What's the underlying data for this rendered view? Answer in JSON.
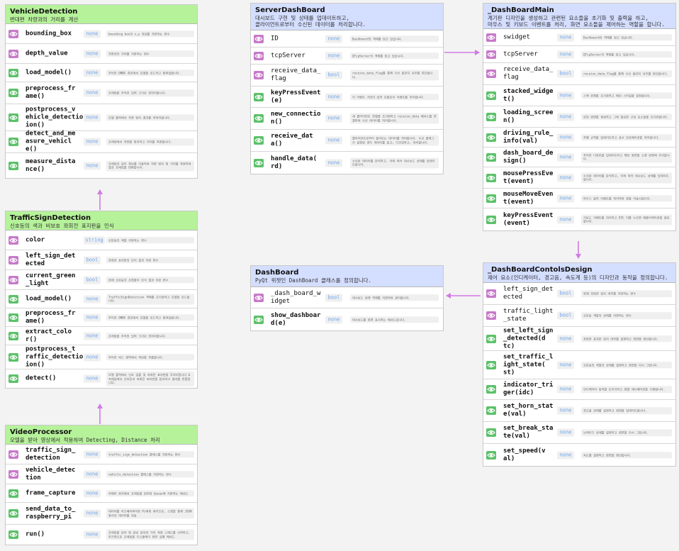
{
  "cards": [
    {
      "id": "vehicle_detection",
      "title": "VehicleDetection",
      "subtitle": "번대편 차량과의 거리를 계산",
      "rows": [
        {
          "name": "bounding_box",
          "bold": true,
          "access": "private",
          "type": "none",
          "desc": "bounding box의 x,y 좌표를 저장하는 변수"
        },
        {
          "name": "depth_value",
          "bold": true,
          "access": "private",
          "type": "none",
          "desc": "차량과의 거리를 저장하는 변수"
        },
        {
          "name": "load_model()",
          "bold": true,
          "access": "public",
          "type": "none",
          "desc": "주어진 ONNX 경로에서 모델을 로드하고 컴파일합니다."
        },
        {
          "name": "preprocess_fr\name()",
          "bold": true,
          "access": "public",
          "type": "none",
          "desc": "프레임을 주어진 입력 크기로 전처리합니다."
        },
        {
          "name": "postprocess_v\nehicle_detection\nion()",
          "bold": true,
          "access": "public",
          "type": "none",
          "desc": "모델 출력에서 차량 탐지 결과를 후처리합니다."
        },
        {
          "name": "detect_and_me\nasure_vehicl\ne()",
          "bold": true,
          "access": "public",
          "type": "none",
          "desc": "프레임에서 차량을 탐지하고 거리를 측정합니다."
        },
        {
          "name": "measure_dista\nnce()",
          "bold": true,
          "access": "public",
          "type": "none",
          "desc": "프레임의 깊이 정보를 이용하여 차량 탐지 및 거리를 측정하여 결과 프레임을 반환합니다."
        }
      ]
    },
    {
      "id": "traffic_sign_detection",
      "title": "TrafficSignDetection",
      "subtitle": "신호등의 색과 비보호 좌회전 표지판을 인식",
      "rows": [
        {
          "name": "color",
          "bold": true,
          "access": "private",
          "type": "string",
          "desc": "신호등의 색을 저장하는 변수"
        },
        {
          "name": "left_sign_det\nected",
          "bold": true,
          "access": "private",
          "type": "bool",
          "desc": "좌회전 표지판의 인식 결과 저장 변수"
        },
        {
          "name": "current_green\n_light",
          "bold": true,
          "access": "private",
          "type": "bool",
          "desc": "현재 신호등의 초록불이 인식 결과 저장 변수"
        },
        {
          "name": "load_model()",
          "bold": true,
          "access": "public",
          "type": "none",
          "desc": "TrafficSignDetection 객체를 초기화하고 모델을 로드합니다."
        },
        {
          "name": "preprocess_fr\name()",
          "bold": true,
          "access": "public",
          "type": "none",
          "desc": "주어진 ONNX 경로에서 모델을 로드하고 컴파일합니다."
        },
        {
          "name": "extract_colo\nr()",
          "bold": true,
          "access": "public",
          "type": "none",
          "desc": "프레임을 주어진 입력 크기로 전처리합니다."
        },
        {
          "name": "postprocess_t\nraffic_detection\nion()",
          "bold": true,
          "access": "public",
          "type": "none",
          "desc": "주어진 박스 영역에서 색상을 추출합니다."
        },
        {
          "name": "detect()",
          "bold": true,
          "access": "public",
          "type": "none",
          "desc": "모델 출력에서 신호 검출 및 좌회전 표지판을 후처리합니다 & 프레임에서 신호등과 좌회전 표지판을 탐지하고 결과를 반환합니다."
        }
      ]
    },
    {
      "id": "video_processor",
      "title": "VideoProcessor",
      "subtitle": "모델을 받아 영상에서 적용하여 Detecting, Distance 처리",
      "rows": [
        {
          "name": "traffic_sign_\ndetection",
          "bold": true,
          "access": "private",
          "type": "none",
          "desc": "traffic_sign_detection 클래스를 저장하는 변수"
        },
        {
          "name": "vehicle_detec\ntion",
          "bold": true,
          "access": "private",
          "type": "none",
          "desc": "vehicle_detection 클래스를 저장하는 변수"
        },
        {
          "name": "frame_capture",
          "bold": true,
          "access": "public",
          "type": "none",
          "desc": "카메라 장치에서 프레임을 읽어와 Queue에 저장하는 메서드"
        },
        {
          "name": "send_data_to_\nraspberry_pi",
          "bold": true,
          "access": "public",
          "type": "none",
          "desc": "데이터를 라즈베리파이와 Pi에게 워커으로, 소켓을 통해 JSON 형식의 데이터를 전송"
        },
        {
          "name": "run()",
          "bold": true,
          "access": "public",
          "type": "none",
          "desc": "프레임을 읽어 및 감상 감지와 거리 측정 스레드를 시작하고, 주기적으로 프레임을 디스플레이 화면 실행 메서드"
        }
      ]
    },
    {
      "id": "server_dashboard",
      "title": "ServerDashBoard",
      "subtitle": "대시보드 구현 및 상태를 업데이트하고,\n클라이언트로부터 수신된 데이터를 처리합니다.",
      "rows": [
        {
          "name": "ID",
          "bold": false,
          "access": "private",
          "type": "none",
          "desc": "Dashboard의 객체를 담고 있습니다."
        },
        {
          "name": "tcpServer",
          "bold": false,
          "access": "private",
          "type": "none",
          "desc": "QTcpServer의 객체를 담고 있습니다."
        },
        {
          "name": "receive_data_\nflag",
          "bold": false,
          "access": "private",
          "type": "bool",
          "desc": "receive_data_flag를 통해 수신 중인지 유무를 판단합니다."
        },
        {
          "name": "keyPressEvent\n(e)",
          "bold": true,
          "access": "public",
          "type": "none",
          "desc": "키 이벤트 기반의 입력 모듈로서 이벤트를 처리합니다."
        },
        {
          "name": "new_connectio\nn()",
          "bold": true,
          "access": "public",
          "type": "none",
          "desc": "새 클라이언트 연결을 초기화하고 receive_data 메서드를 연결하여 수신 데이터를 처리합니다."
        },
        {
          "name": "receive_dat\na()",
          "bold": true,
          "access": "public",
          "type": "none",
          "desc": "클라이언트로부터 들어오는 데이터를 처리합니다. 수신 플래그가 설정된 경우 데이터를 읽고, 디코딩하고, 처리합니다."
        },
        {
          "name": "handle_data(\nrd)",
          "bold": true,
          "access": "public",
          "type": "none",
          "desc": "수신된 데이터를 분석하고, 이에 따라 대시보드 상태를 업데이트합니다."
        }
      ]
    },
    {
      "id": "dashboard_main",
      "title": "_DashBoardMain",
      "subtitle": "계기판 디자인을 생성하고 관련된 요소들을 초기화 및 출력을 하고,\n마우스 및 키보드 이벤트를 처리, 화면 요소들을 제어하는 역할을 합니다.",
      "rows": [
        {
          "name": "swidget",
          "bold": false,
          "access": "private",
          "type": "none",
          "desc": "Dashboard의 객체를 담고 있습니다."
        },
        {
          "name": "tcpServer",
          "bold": false,
          "access": "private",
          "type": "none",
          "desc": "QTcpServer의 객체를 담고 있습니다."
        },
        {
          "name": "receive_data_\nflag",
          "bold": false,
          "access": "private",
          "type": "bool",
          "desc": "receive_data_flag를 통해 수신 중인지 유무를 판단합니다."
        },
        {
          "name": "stacked_widge\nt()",
          "bold": true,
          "access": "public",
          "type": "none",
          "desc": "스택 위젯을 초기화하고 메인 스타일을 설정합니다."
        },
        {
          "name": "loading_scree\nn()",
          "bold": true,
          "access": "public",
          "type": "none",
          "desc": "로딩 화면을 생성하고 그에 필요한 구성 요소들을 초기화합니다."
        },
        {
          "name": "driving_rule_\ninfo(val)",
          "bold": true,
          "access": "public",
          "type": "none",
          "desc": "주행 규칙을 업데이트하고 표시 인포메이션을 처리합니다."
        },
        {
          "name": "dash_board_de\nsign()",
          "bold": true,
          "access": "public",
          "type": "none",
          "desc": "주어진 디자인을 업데이트하고 해당 화면을 소켓 위젯에 추가합니다."
        },
        {
          "name": "mousePressEve\nt(event)",
          "bold": true,
          "access": "public",
          "type": "none",
          "desc": "수신된 데이터를 분석하고, 이에 따라 대시보드 상태를 업데이트합니다."
        },
        {
          "name": "mouseMoveEven\nt(event)",
          "bold": true,
          "access": "public",
          "type": "none",
          "desc": "마우스 움직 이벤트를 처리하여 창을 이동시킵니다."
        },
        {
          "name": "keyPressEvent\n(event)",
          "bold": true,
          "access": "public",
          "type": "none",
          "desc": "키보드 이벤트를 처리하고 ESC 키를 누르면 애플리케이션을 종료합니다."
        }
      ]
    },
    {
      "id": "dashboard",
      "title": "DashBoard",
      "subtitle": "PyQt 위젯인 DashBoard 클래스를 정의합니다.",
      "rows": [
        {
          "name": "_dash_board_w\nidget",
          "bold": false,
          "access": "private",
          "type": "bool",
          "desc": "대시보드 위젯 객체를 저장하여 관리합니다."
        },
        {
          "name": "show_dashboar\nd(e)",
          "bold": true,
          "access": "public",
          "type": "none",
          "desc": "대시보드를 화면 표시하는 메서드입니다."
        }
      ]
    },
    {
      "id": "dashboard_controls_design",
      "title": "_DashBoardContolsDesign",
      "subtitle": "제어 요소(인디케이터, 경고음, 속도계 등)의 디자인과 동작을 정의합니다.",
      "rows": [
        {
          "name": "left_sign_det\nected",
          "bold": false,
          "access": "private",
          "type": "bool",
          "desc": "현재 좌회전 감지 여부를 저장하는 변수"
        },
        {
          "name": "traffic_light\n_state",
          "bold": false,
          "access": "private",
          "type": "bool",
          "desc": "신호등 색깔의 상태를 저장하는 변수"
        },
        {
          "name": "set_left_sign\n_detected(d\ntc)",
          "bold": true,
          "access": "public",
          "type": "none",
          "desc": "좌회전 표지판 감지 여부를 설정하고 화면을 갱신합니다."
        },
        {
          "name": "set_traffic_l\night_state(\nst)",
          "bold": true,
          "access": "public",
          "type": "none",
          "desc": "신호등의 색깔의 상태를 설정하고 화면을 다시 그립니다."
        },
        {
          "name": "indicator_tri\nger(idc)",
          "bold": true,
          "access": "public",
          "type": "none",
          "desc": "인디케이터 동작을 트리거하고 점멸 애니메이션을 수행합니다."
        },
        {
          "name": "set_horn_stat\ne(val)",
          "bold": true,
          "access": "public",
          "type": "none",
          "desc": "경고음 상태를 설정하고 화면을 업데이트합니다."
        },
        {
          "name": "set_break_sta\nte(val)",
          "bold": true,
          "access": "public",
          "type": "none",
          "desc": "브레이크 상태를 설정하고 화면을 다시 그립니다."
        },
        {
          "name": "set_speed(v\nal)",
          "bold": true,
          "access": "public",
          "type": "none",
          "desc": "속도를 설정하고 화면을 갱신합니다."
        }
      ]
    }
  ],
  "colors": {
    "green_header": "#b6f29a",
    "blue_header": "#d4deff",
    "private": "#c77ac9",
    "public": "#5cc16a",
    "arrow": "#d27be3"
  }
}
